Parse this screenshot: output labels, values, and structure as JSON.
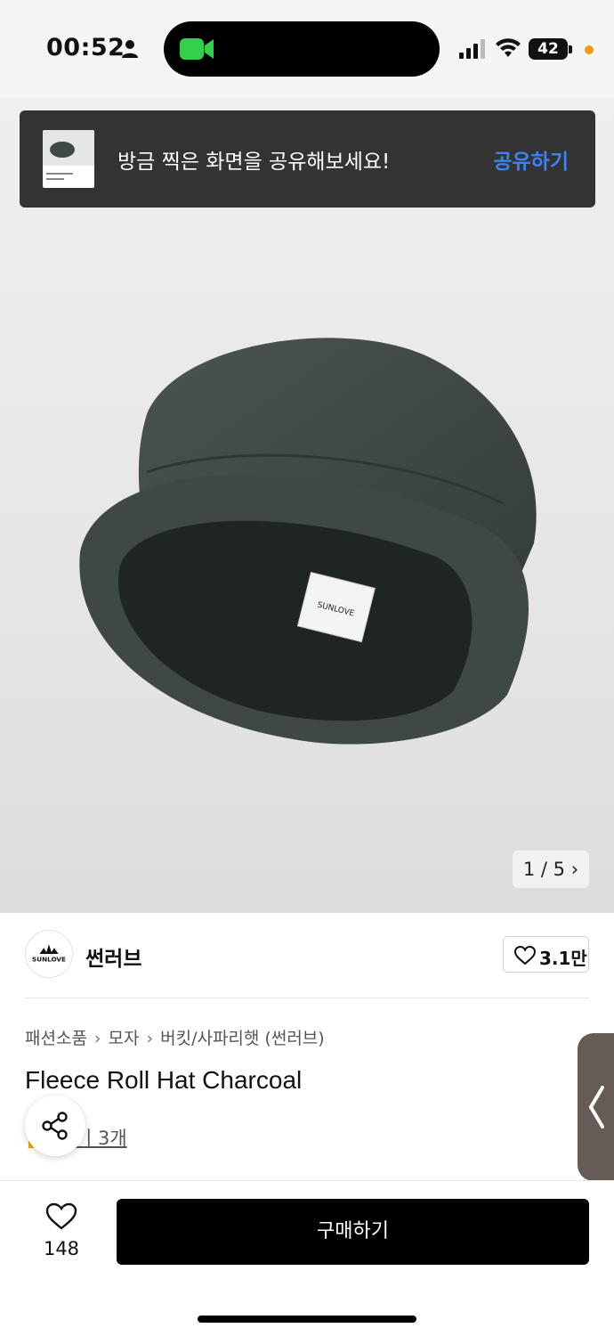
{
  "status_bar": {
    "time": "00:52",
    "battery": "42",
    "icons": [
      "person-icon",
      "facetime-icon",
      "signal-icon",
      "wifi-icon",
      "battery-icon",
      "mic-indicator"
    ]
  },
  "toast": {
    "message": "방금 찍은 화면을 공유해보세요!",
    "action_label": "공유하기",
    "action_color": "#3b82f6"
  },
  "gallery": {
    "page_indicator": "1 / 5",
    "current": 1,
    "total": 5
  },
  "brand": {
    "name": "썬러브",
    "logo_text": "SUNLOVE",
    "likes": "3.1만"
  },
  "breadcrumb": [
    "패션소품",
    "모자",
    "버킷/사파리햇 (썬러브)"
  ],
  "product": {
    "title": "Fleece Roll Hat Charcoal",
    "review_link": "기 3개"
  },
  "bottom_bar": {
    "wish_count": "148",
    "buy_label": "구매하기"
  },
  "colors": {
    "accent": "#3b82f6",
    "buy_button": "#000000",
    "toast_bg": "#333333",
    "hat": "#3f4846"
  }
}
